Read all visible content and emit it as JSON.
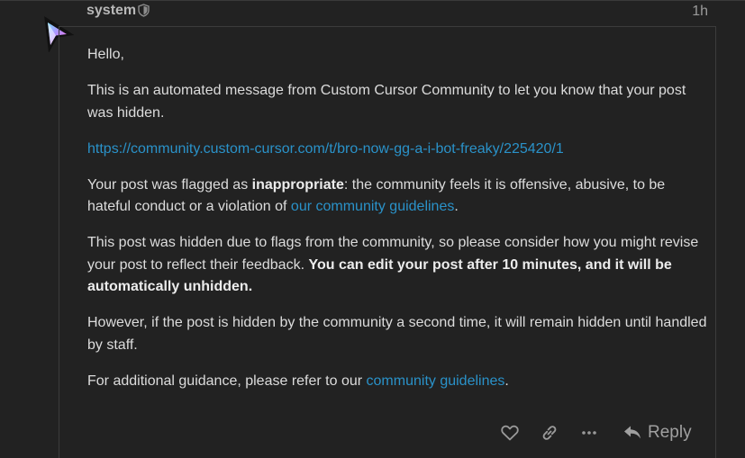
{
  "post": {
    "username": "system",
    "time": "1h",
    "paragraphs": {
      "greeting": "Hello,",
      "intro": "This is an automated message from Custom Cursor Community to let you know that your post was hidden.",
      "link": "https://community.custom-cursor.com/t/bro-now-gg-a-i-bot-freaky/225420/1",
      "flag_prefix": "Your post was flagged as ",
      "flag_bold": "inappropriate",
      "flag_mid": ": the community feels it is offensive, abusive, to be hateful conduct or a violation of ",
      "flag_link": "our community guidelines",
      "flag_end": ".",
      "hidden_text": "This post was hidden due to flags from the community, so please consider how you might revise your post to reflect their feedback. ",
      "hidden_bold": "You can edit your post after 10 minutes, and it will be automatically unhidden.",
      "second_time": "However, if the post is hidden by the community a second time, it will remain hidden until handled by staff.",
      "guidance_prefix": "For additional guidance, please refer to our ",
      "guidance_link": "community guidelines",
      "guidance_end": "."
    }
  },
  "actions": {
    "reply_label": "Reply"
  },
  "icons": {
    "like": "heart-icon",
    "copy_link": "link-icon",
    "more": "ellipsis-icon",
    "reply": "reply-arrow-icon",
    "badge": "shield-icon",
    "avatar": "cursor-arrow-icon"
  },
  "colors": {
    "background": "#222222",
    "text": "#dcdcdc",
    "link": "#2a92c9",
    "muted": "#9a9a9a"
  }
}
